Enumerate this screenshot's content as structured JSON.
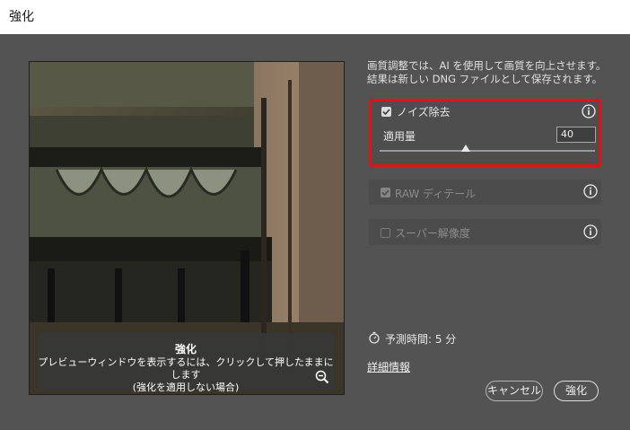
{
  "window": {
    "title": "強化"
  },
  "preview": {
    "overlay_title": "強化",
    "overlay_line1": "プレビューウィンドウを表示するには、クリックして押したままにします",
    "overlay_line2": "(強化を適用しない場合)"
  },
  "description": "画質調整では、AI を使用して画質を向上させます。結果は新しい DNG ファイルとして保存されます。",
  "noise": {
    "label": "ノイズ除去",
    "checked": true,
    "amount_label": "適用量",
    "amount_value": "40",
    "slider_percent": 40
  },
  "raw_detail": {
    "label": "RAW ディテール",
    "checked": true,
    "disabled": true
  },
  "super_resolution": {
    "label": "スーパー解像度",
    "checked": false,
    "disabled": true
  },
  "estimated_time": "予測時間: 5 分",
  "details_link": "詳細情報",
  "buttons": {
    "cancel": "キャンセル",
    "enhance": "強化"
  },
  "colors": {
    "highlight_border": "#d9151b",
    "dialog_bg": "#535353"
  }
}
